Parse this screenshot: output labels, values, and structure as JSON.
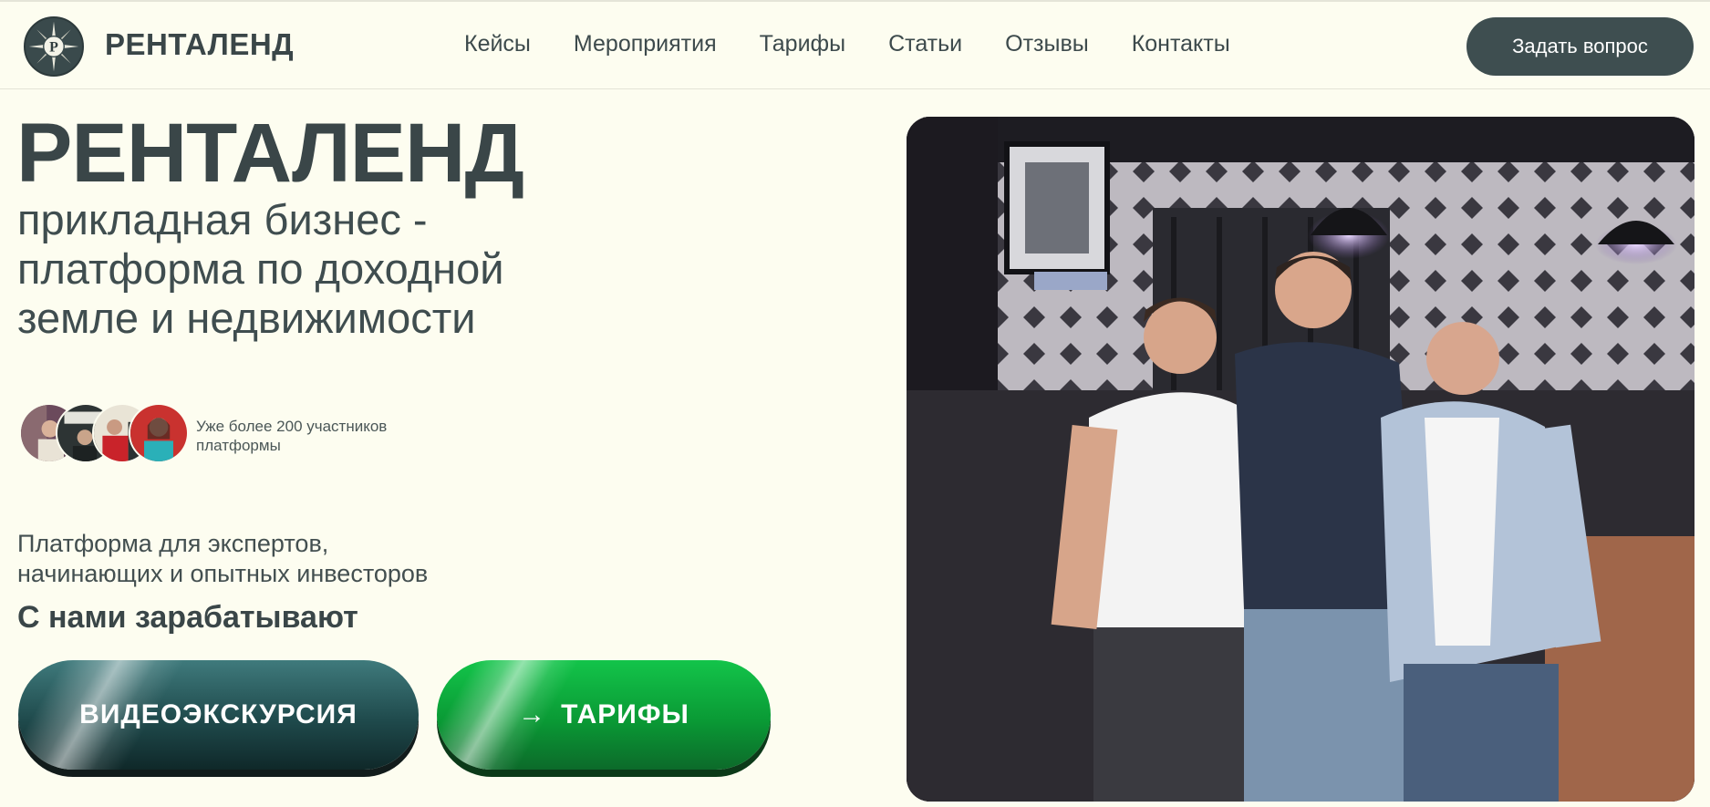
{
  "header": {
    "brand": "РЕНТАЛЕНД",
    "logo_icon": "compass-logo-icon",
    "logo_letter": "P",
    "nav": [
      "Кейсы",
      "Мероприятия",
      "Тарифы",
      "Статьи",
      "Отзывы",
      "Контакты"
    ],
    "ask_button": "Задать вопрос"
  },
  "hero": {
    "title": "РЕНТАЛЕНД",
    "subtitle_lines": [
      "прикладная бизнес -",
      "платформа по доходной",
      "земле и недвижимости"
    ],
    "members_text": "Уже более 200 участников платформы",
    "avatars": [
      "avatar-1",
      "avatar-2",
      "avatar-3",
      "avatar-4"
    ],
    "description_lines": [
      "Платформа для экспертов,",
      "начинающих и опытных инвесторов"
    ],
    "earn": "С нами зарабатывают",
    "video_button": "ВИДЕОЭКСКУРСИЯ",
    "tariffs_button": "ТАРИФЫ",
    "tariffs_icon": "arrow-right-icon"
  },
  "colors": {
    "background": "#fdfdf0",
    "text": "#3a4648",
    "dark_button": "#3e4e50",
    "teal_button": "#1f4a4c",
    "green_button": "#0a9a35"
  }
}
